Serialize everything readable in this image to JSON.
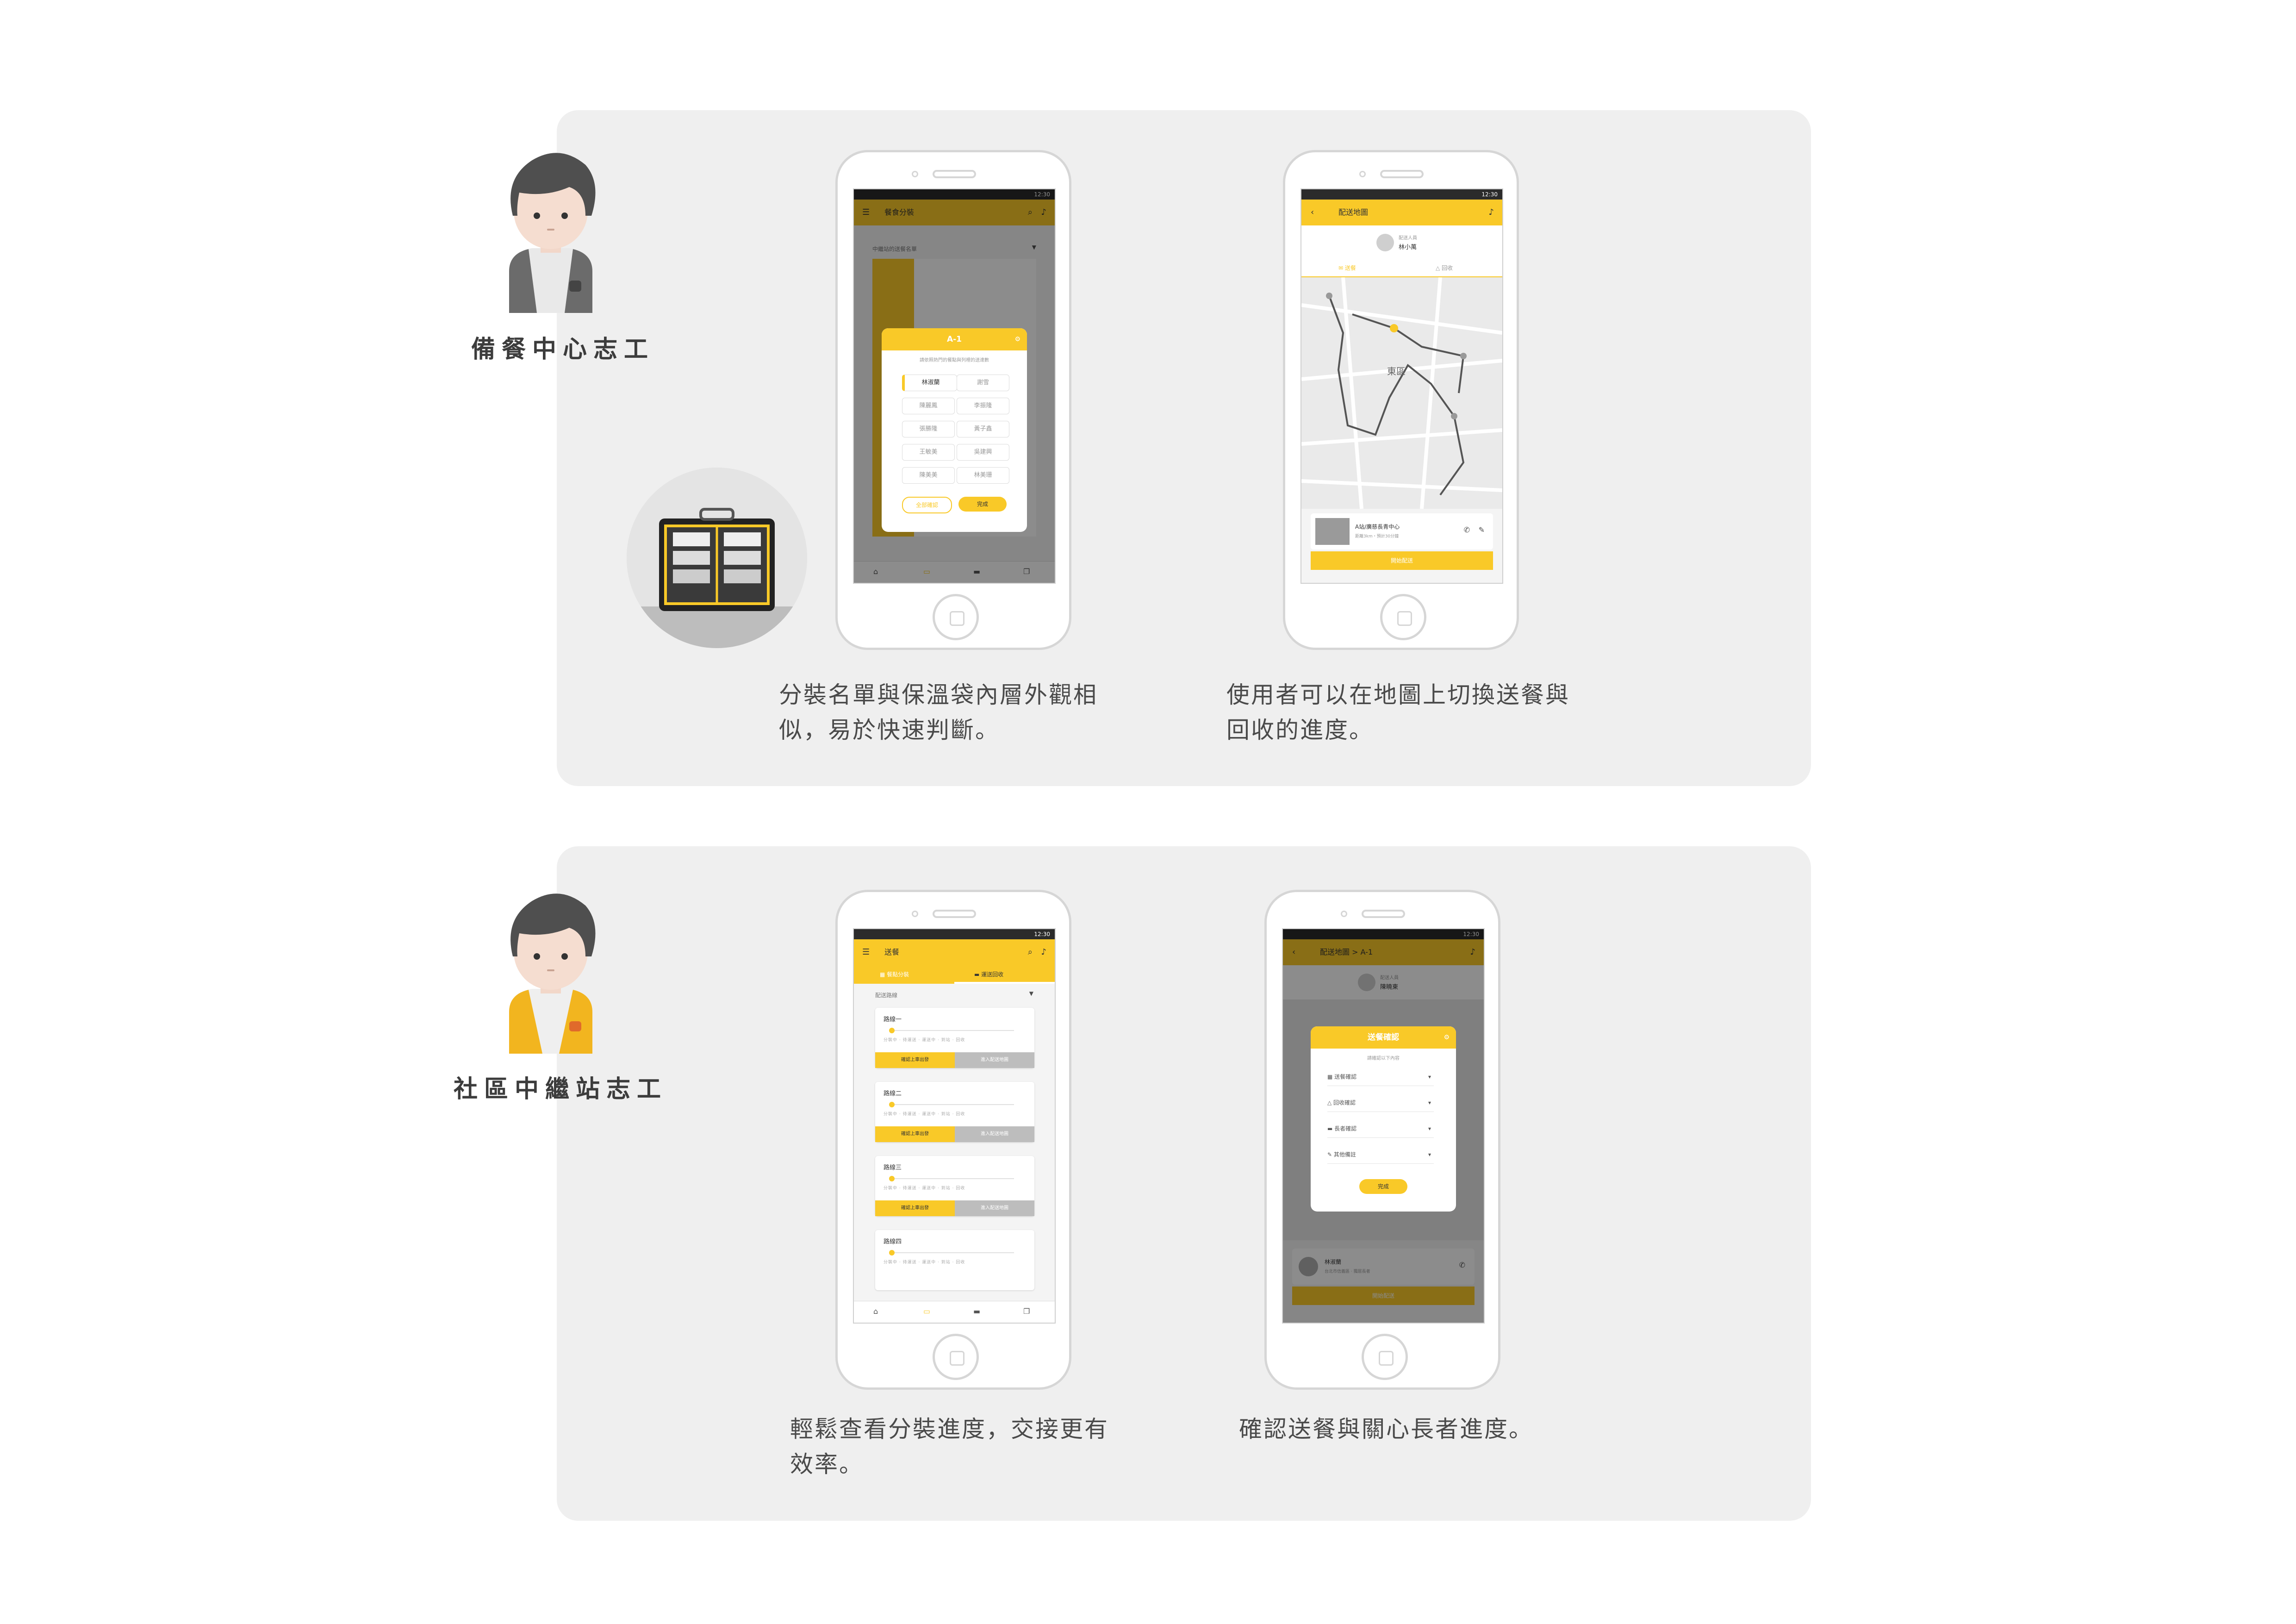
{
  "colors": {
    "accent": "#f9c928",
    "panel": "#efefef",
    "phone_frame": "#d6d6d6"
  },
  "section1": {
    "role": "備餐中心志工",
    "caption1": "分裝名單與保溫袋內層外觀相似，易於快速判斷。",
    "caption2": "使用者可以在地圖上切換送餐與回收的進度。",
    "phone1": {
      "status_time": "12:30",
      "app_title": "餐食分裝",
      "list_hint": "中繼站的送餐名單",
      "modal_title": "A-1",
      "modal_hint": "請依照熱門的餐點與列裡的送達數",
      "names": [
        "林淑蘭",
        "謝雪",
        "陳麗鳳",
        "李振隆",
        "張勝隆",
        "黃子鑫",
        "王敏美",
        "吳建興",
        "陳美美",
        "林美珊"
      ],
      "btn_left": "全部確認",
      "btn_right": "完成"
    },
    "phone2": {
      "status_time": "12:30",
      "app_title": "配送地圖",
      "courier_role": "配送人員",
      "courier_name": "林小萬",
      "tab_delivery": "送餐",
      "tab_recycle": "回收",
      "map_label": "東區",
      "stop_name": "A站/廣慈長青中心",
      "stop_detail": "距離3km・預計30分鐘",
      "btn_start": "開始配送"
    }
  },
  "section2": {
    "role": "社區中繼站志工",
    "caption1": "輕鬆查看分裝進度，交接更有效率。",
    "caption2": "確認送餐與關心長者進度。",
    "phone3": {
      "status_time": "12:30",
      "app_title": "送餐",
      "tab1": "餐點分裝",
      "tab2": "運送回收",
      "filter": "配送路線",
      "routes": [
        "路線一",
        "路線二",
        "路線三",
        "路線四"
      ],
      "steps": "分裝中 · 待運送 · 運送中 · 到站 · 回收",
      "btn_left": "確認上車出發",
      "btn_right": "進入配送地圖"
    },
    "phone4": {
      "status_time": "12:30",
      "app_title": "配送地圖 > A-1",
      "courier_role": "配送人員",
      "courier_name": "陳曉東",
      "modal_title": "送餐確認",
      "modal_hint": "請確認以下內容",
      "rows": [
        "送餐確認",
        "回收確認",
        "長者確認",
        "其他備註"
      ],
      "btn_done": "完成",
      "elder_name": "林淑蘭",
      "elder_detail": "台北市信義區 · 獨居長者",
      "btn_start": "開始配送"
    }
  }
}
